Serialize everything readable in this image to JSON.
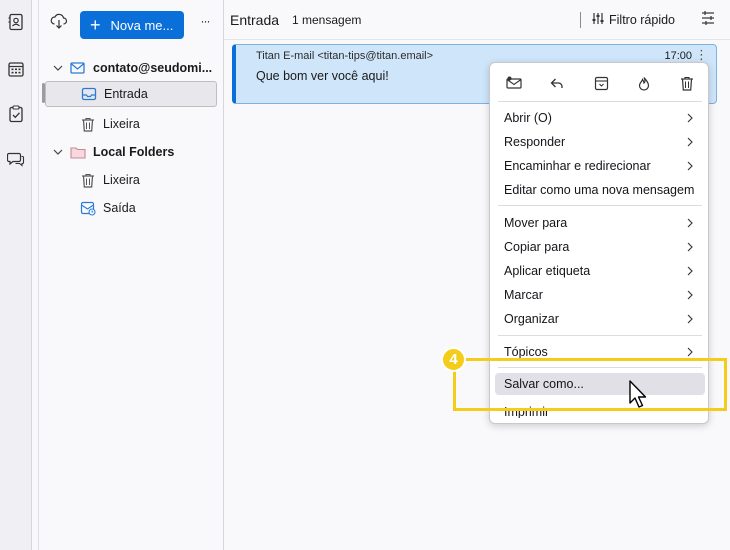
{
  "folder_pane": {
    "new_message_label": "Nova me...",
    "more_label": "···",
    "account": "contato@seudomi...",
    "folders": [
      "Entrada",
      "Lixeira"
    ],
    "local_folders_label": "Local Folders",
    "local_folders": [
      "Lixeira",
      "Saída"
    ]
  },
  "thread_pane": {
    "folder_title": "Entrada",
    "message_count": "1 mensagem",
    "quick_filter_label": "Filtro rápido"
  },
  "message": {
    "sender": "Titan E-mail <titan-tips@titan.email>",
    "time": "17:00",
    "subject": "Que bom ver você aqui!"
  },
  "context_menu": {
    "icons": [
      "mark-read-icon",
      "reply-icon",
      "archive-icon",
      "junk-icon",
      "delete-icon"
    ],
    "group1": [
      "Abrir (O)",
      "Responder",
      "Encaminhar e redirecionar",
      "Editar como uma nova mensagem"
    ],
    "group2": [
      "Mover para",
      "Copiar para",
      "Aplicar etiqueta",
      "Marcar",
      "Organizar"
    ],
    "group3": [
      "Tópicos",
      "Salvar como...",
      "Imprimir"
    ]
  },
  "annotation": {
    "step_number": "4"
  },
  "colors": {
    "accent": "#0a6fd8",
    "selection": "#cfe6fa",
    "highlight": "#f4cc1a"
  }
}
